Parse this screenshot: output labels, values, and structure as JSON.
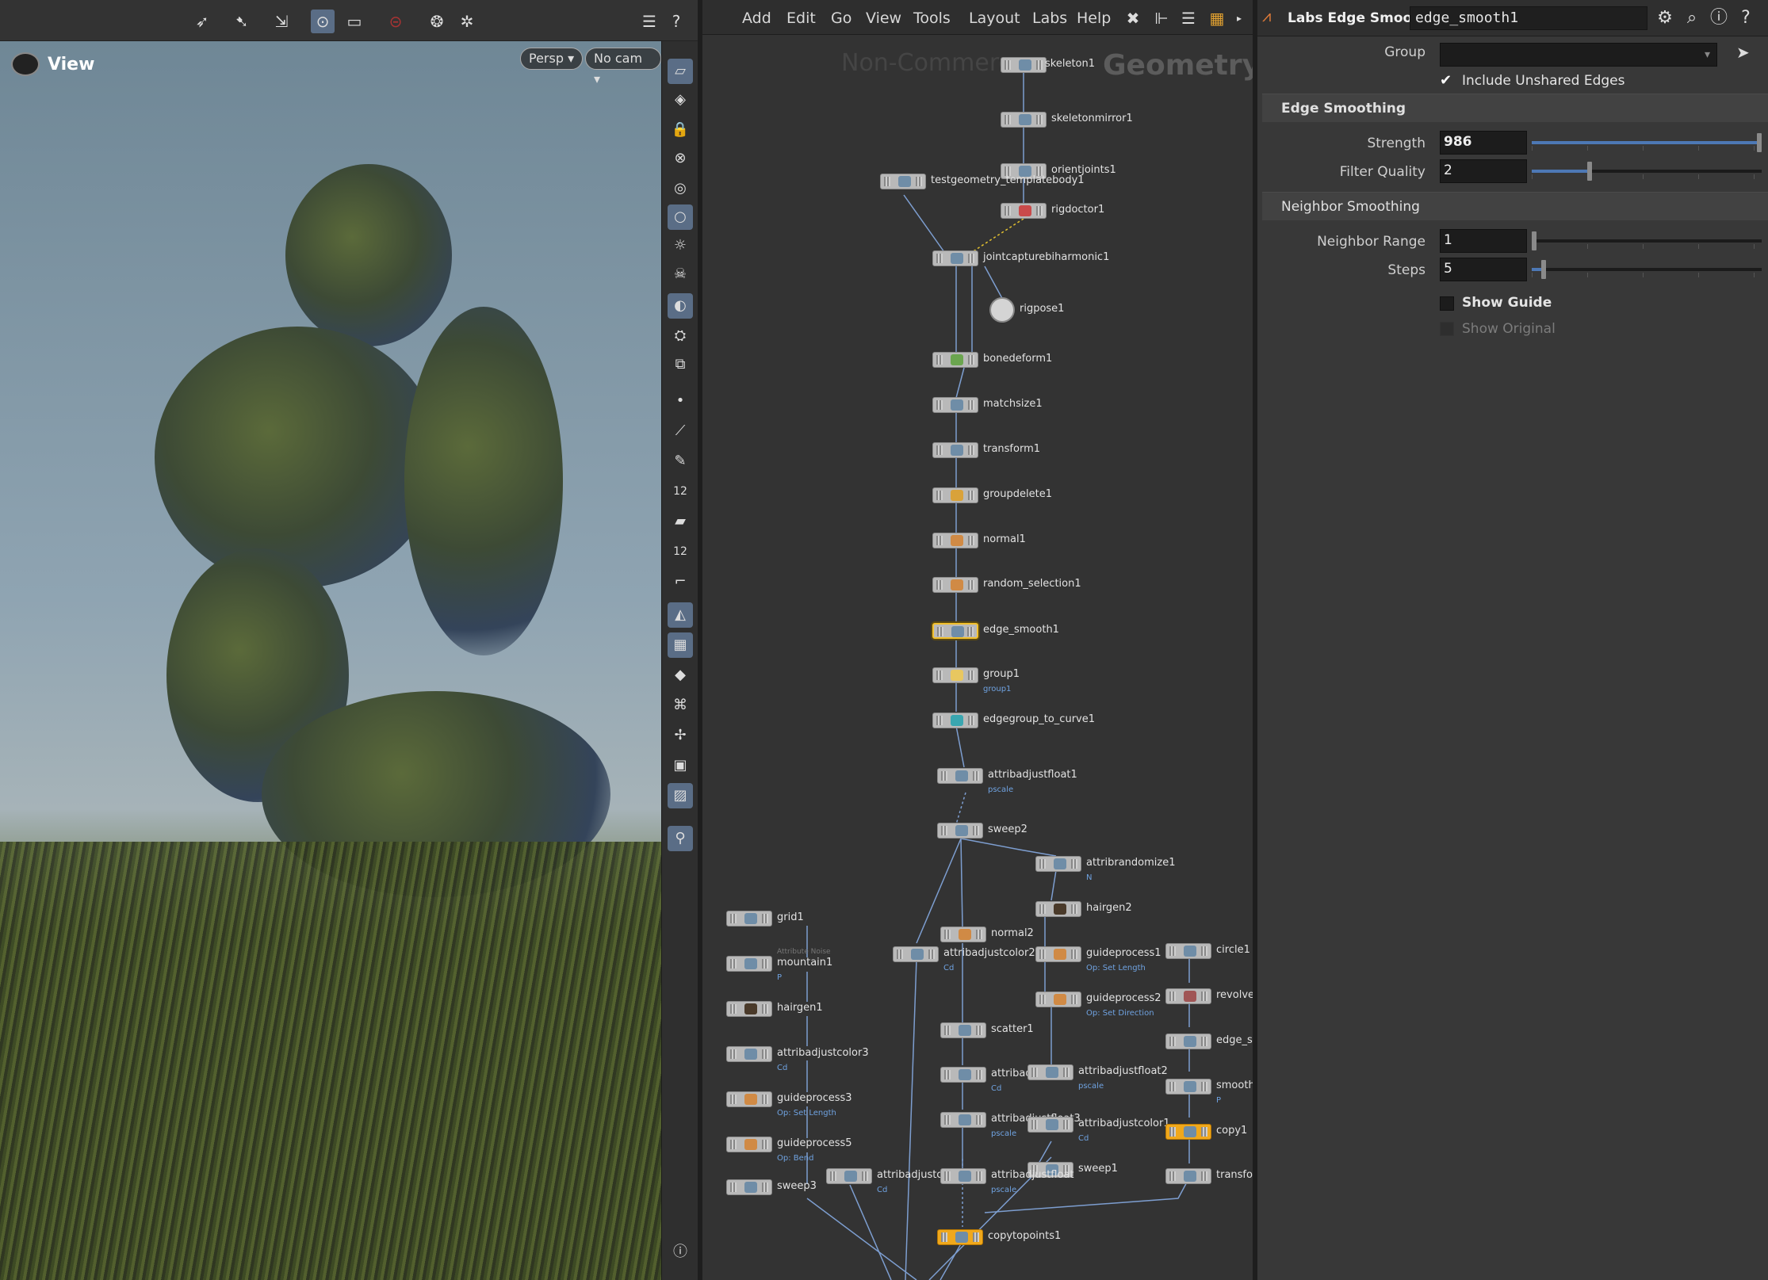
{
  "viewport": {
    "title": "View",
    "camera_mode": "Persp",
    "camera_select": "No cam",
    "toolbar_icons": [
      "select-icon",
      "move-icon",
      "handle-icon",
      "camera-icon",
      "display-options-icon",
      "stop-icon",
      "snapshot-icon",
      "render-icon"
    ],
    "side_icons": [
      "ground-plane-icon",
      "wireframe-icon",
      "lock-icon",
      "ghost-icon",
      "shading-icon",
      "light-icon",
      "headlight-icon",
      "skull-icon",
      "camera-light-icon",
      "template-icon",
      "render-region-icon",
      "point-icon",
      "normal-icon",
      "picker-icon",
      "point-numbers-label",
      "brush-icon",
      "prim-numbers-label",
      "edge-icon",
      "shaded-icon",
      "checker-icon",
      "diamond-icon",
      "uv-icon",
      "transform-icon",
      "background-icon",
      "image-icon",
      "pin-icon",
      "info-icon"
    ],
    "side_labels": {
      "point_numbers": "12",
      "prim_numbers": "12"
    }
  },
  "network": {
    "menu": [
      "Add",
      "Edit",
      "Go",
      "View",
      "Tools",
      "Layout",
      "Labs",
      "Help"
    ],
    "watermark_left": "Non-Commerc",
    "watermark_right": "Geometry",
    "nodes": [
      {
        "name": "skeleton1"
      },
      {
        "name": "skeletonmirror1"
      },
      {
        "name": "orientjoints1"
      },
      {
        "name": "testgeometry_templatebody1"
      },
      {
        "name": "rigdoctor1"
      },
      {
        "name": "jointcapturebiharmonic1"
      },
      {
        "name": "rigpose1"
      },
      {
        "name": "bonedeform1"
      },
      {
        "name": "matchsize1"
      },
      {
        "name": "transform1"
      },
      {
        "name": "groupdelete1"
      },
      {
        "name": "normal1"
      },
      {
        "name": "random_selection1"
      },
      {
        "name": "edge_smooth1"
      },
      {
        "name": "group1",
        "sub": "group1"
      },
      {
        "name": "edgegroup_to_curve1"
      },
      {
        "name": "attribadjustfloat1",
        "sub": "pscale"
      },
      {
        "name": "sweep2"
      },
      {
        "name": "attribrandomize1",
        "sub": "N"
      },
      {
        "name": "hairgen2"
      },
      {
        "name": "grid1"
      },
      {
        "name": "mountain1",
        "sup": "Attribute Noise",
        "sub": "P"
      },
      {
        "name": "normal2"
      },
      {
        "name": "attribadjustcolor2",
        "sub": "Cd"
      },
      {
        "name": "guideprocess1",
        "sub": "Op: Set Length"
      },
      {
        "name": "circle1"
      },
      {
        "name": "hairgen1"
      },
      {
        "name": "guideprocess2",
        "sub": "Op: Set Direction"
      },
      {
        "name": "revolve"
      },
      {
        "name": "scatter1"
      },
      {
        "name": "edge_s"
      },
      {
        "name": "attribadjustcolor3",
        "sub": "Cd"
      },
      {
        "name": "attribad",
        "sub": "Cd"
      },
      {
        "name": "attribadjustfloat2",
        "sub": "pscale"
      },
      {
        "name": "smooth",
        "sub": "P"
      },
      {
        "name": "guideprocess3",
        "sub": "Op: Set Length"
      },
      {
        "name": "attribadjustfloat3",
        "sub": "pscale"
      },
      {
        "name": "attribadjustcolor1",
        "sub": "Cd"
      },
      {
        "name": "copy1"
      },
      {
        "name": "guideprocess5",
        "sub": "Op: Bend"
      },
      {
        "name": "sweep1"
      },
      {
        "name": "sweep3"
      },
      {
        "name": "attribadjustcol",
        "sub": "Cd"
      },
      {
        "name": "attribadjustfloat",
        "sub": "pscale"
      },
      {
        "name": "transfo"
      },
      {
        "name": "copytopoints1"
      }
    ]
  },
  "params": {
    "node_type": "Labs Edge Smooth",
    "node_name": "edge_smooth1",
    "group_label": "Group",
    "group_value": "",
    "include_unshared_label": "Include Unshared Edges",
    "include_unshared_checked": true,
    "section_edge": "Edge Smoothing",
    "strength_label": "Strength",
    "strength_value": "986",
    "strength_fraction": 0.99,
    "filter_label": "Filter Quality",
    "filter_value": "2",
    "filter_fraction": 0.25,
    "section_neighbor": "Neighbor Smoothing",
    "range_label": "Neighbor Range",
    "range_value": "1",
    "range_fraction": 0.0,
    "steps_label": "Steps",
    "steps_value": "5",
    "steps_fraction": 0.05,
    "show_guide_label": "Show Guide",
    "show_guide_checked": false,
    "show_original_label": "Show Original",
    "show_original_checked": false
  },
  "colors": {
    "accent_blue": "#4d78b5",
    "selected_outline": "#f2c12e",
    "display_flag": "#f0a81c",
    "attr_text": "#6fa2e0"
  }
}
